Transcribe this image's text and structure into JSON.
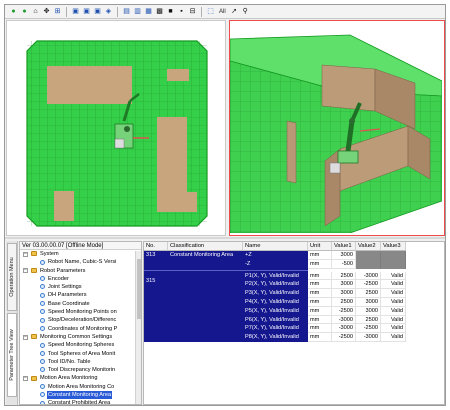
{
  "toolbar": {
    "all_label": "All",
    "icons": [
      "back-icon",
      "forward-icon",
      "home-icon",
      "pan-icon",
      "zoom-fit-icon",
      "view-top-icon",
      "view-front-icon",
      "view-side-icon",
      "view-iso-icon",
      "view-layout-icon",
      "view-split-icon",
      "view-quad-icon",
      "grid-icon",
      "solid-icon",
      "black-square-icon",
      "ruler-icon",
      "select-all-icon",
      "pointer-icon",
      "search-icon"
    ]
  },
  "colors": {
    "zone_green": "#35d04a",
    "zone_green_dark": "#1a9a2a",
    "block_tan": "#c9a57e",
    "navy": "#15178f",
    "active_view_border": "#ef4b4b"
  },
  "tree": {
    "header": "Ver 03.00.00.07 [Offline Mode]",
    "items": [
      {
        "label": "System",
        "type": "folder",
        "level": 0,
        "expanded": true
      },
      {
        "label": "Robot Name, Cubic-S Versi",
        "type": "leaf",
        "level": 1
      },
      {
        "label": "Robot Parameters",
        "type": "folder",
        "level": 0,
        "expanded": true
      },
      {
        "label": "Encoder",
        "type": "leaf",
        "level": 1
      },
      {
        "label": "Joint Settings",
        "type": "leaf",
        "level": 1
      },
      {
        "label": "DH Parameters",
        "type": "leaf",
        "level": 1
      },
      {
        "label": "Base Coordinate",
        "type": "leaf",
        "level": 1
      },
      {
        "label": "Speed Monitoring Points on",
        "type": "leaf",
        "level": 1
      },
      {
        "label": "Stop/Deceleration/Differenc",
        "type": "leaf",
        "level": 1
      },
      {
        "label": "Coordinates of Monitoring P",
        "type": "leaf",
        "level": 1
      },
      {
        "label": "Monitoring Common Settings",
        "type": "folder",
        "level": 0,
        "expanded": true
      },
      {
        "label": "Speed Monitoring Spheres",
        "type": "leaf",
        "level": 1
      },
      {
        "label": "Tool Spheres of Area Monit",
        "type": "leaf",
        "level": 1
      },
      {
        "label": "Tool ID/No. Table",
        "type": "leaf",
        "level": 1
      },
      {
        "label": "Tool Discrepancy Monitorin",
        "type": "leaf",
        "level": 1
      },
      {
        "label": "Motion Area Monitoring",
        "type": "folder",
        "level": 0,
        "expanded": true
      },
      {
        "label": "Motion Area Monitoring Co",
        "type": "leaf",
        "level": 1
      },
      {
        "label": "Constant Monitoring Area",
        "type": "leaf",
        "level": 1,
        "selected": true
      },
      {
        "label": "Constant Prohibited Area",
        "type": "leaf",
        "level": 1
      }
    ]
  },
  "side_tabs": [
    "Operation Menu",
    "Parameter Tree View"
  ],
  "table": {
    "headers": [
      "No.",
      "Classification",
      "Name",
      "Unit",
      "Value1",
      "Value2",
      "Value3"
    ],
    "group": {
      "no": "313",
      "classification": "Constant Monitoring Area"
    },
    "group2_no": "315",
    "rows": [
      {
        "name": "+Z",
        "unit": "mm",
        "v1": "3000",
        "v2": "",
        "v3": "",
        "gray": true
      },
      {
        "name": "-Z",
        "unit": "mm",
        "v1": "-500",
        "v2": "",
        "v3": "",
        "gray": true
      },
      {
        "name": "P1(X, Y), Valid/Invalid",
        "unit": "mm",
        "v1": "2500",
        "v2": "-3000",
        "v3": "Valid"
      },
      {
        "name": "P2(X, Y), Valid/Invalid",
        "unit": "mm",
        "v1": "3000",
        "v2": "-2500",
        "v3": "Valid"
      },
      {
        "name": "P3(X, Y), Valid/Invalid",
        "unit": "mm",
        "v1": "3000",
        "v2": "2500",
        "v3": "Valid"
      },
      {
        "name": "P4(X, Y), Valid/Invalid",
        "unit": "mm",
        "v1": "2500",
        "v2": "3000",
        "v3": "Valid"
      },
      {
        "name": "P5(X, Y), Valid/Invalid",
        "unit": "mm",
        "v1": "-2500",
        "v2": "3000",
        "v3": "Valid"
      },
      {
        "name": "P6(X, Y), Valid/Invalid",
        "unit": "mm",
        "v1": "-3000",
        "v2": "2500",
        "v3": "Valid"
      },
      {
        "name": "P7(X, Y), Valid/Invalid",
        "unit": "mm",
        "v1": "-3000",
        "v2": "-2500",
        "v3": "Valid"
      },
      {
        "name": "P8(X, Y), Valid/Invalid",
        "unit": "mm",
        "v1": "-2500",
        "v2": "-3000",
        "v3": "Valid"
      }
    ]
  }
}
